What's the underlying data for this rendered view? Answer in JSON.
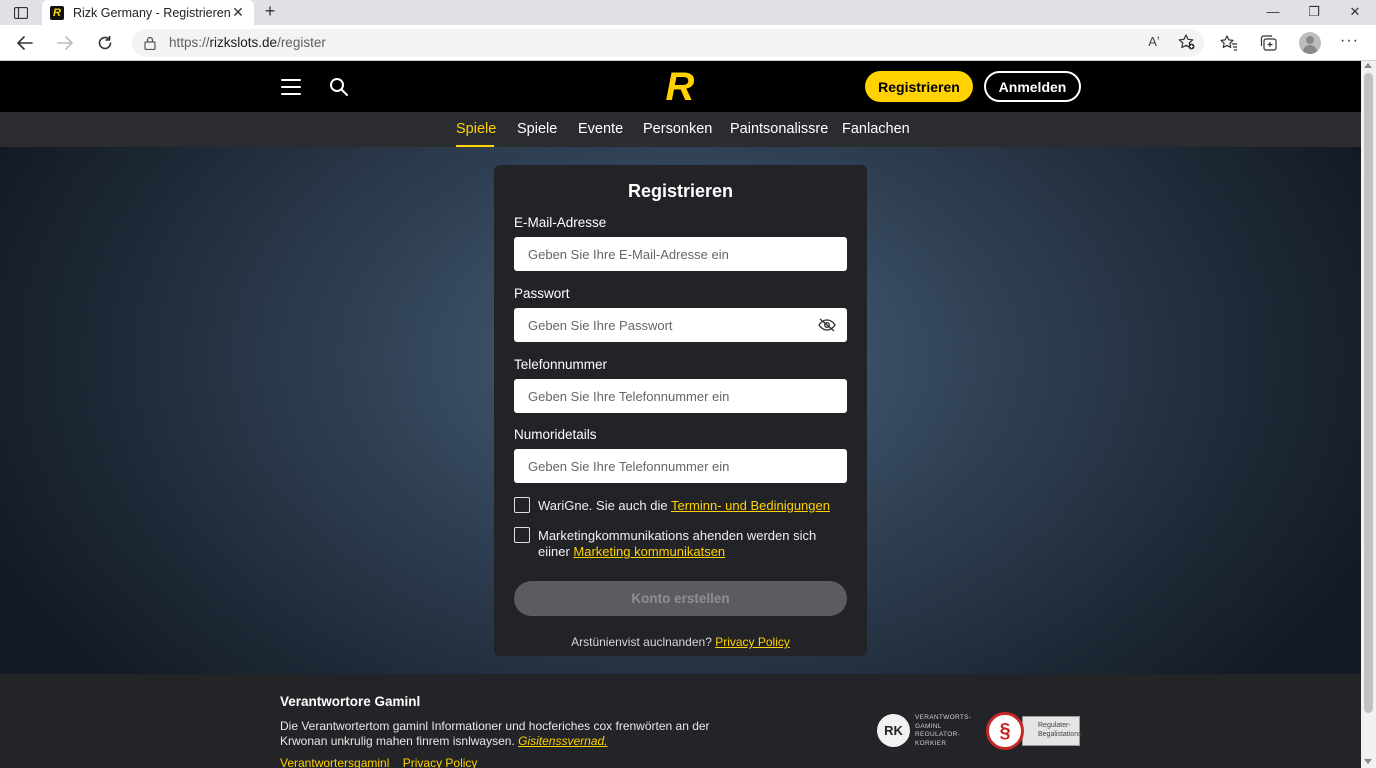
{
  "browser": {
    "tab_title": "Rizk Germany - Registrieren",
    "tab_favicon_letter": "R",
    "url_prefix": "https://",
    "url_host": "rizkslots.de",
    "url_path": "/register",
    "read_aloud_label": "Aʼ"
  },
  "header": {
    "logo_letter": "R",
    "register_button": "Registrieren",
    "login_button": "Anmelden",
    "brand_color": "#ffd200"
  },
  "subnav": {
    "items": [
      {
        "label": "Spiele",
        "active": true
      },
      {
        "label": "Spiele",
        "active": false
      },
      {
        "label": "Evente",
        "active": false
      },
      {
        "label": "Personken",
        "active": false
      },
      {
        "label": "Paintsonalissre",
        "active": false
      },
      {
        "label": "Fanlachen",
        "active": false
      }
    ]
  },
  "form": {
    "title": "Registrieren",
    "email_label": "E-Mail-Adresse",
    "email_placeholder": "Geben Sie Ihre E-Mail-Adresse ein",
    "password_label": "Passwort",
    "password_placeholder": "Geben Sie Ihre Passwort",
    "phone_label": "Telefonnummer",
    "phone_placeholder": "Geben Sie Ihre Telefonnummer ein",
    "number_label": "Numoridetails",
    "number_placeholder": "Geben Sie Ihre Telefonnummer ein",
    "terms_text": "WariGne. Sie auch die ",
    "terms_link": "Terminn- und Bedinigungen",
    "terms_checked": false,
    "marketing_text": "Marketingkommunikations ahenden werden sich eiiner ",
    "marketing_link": "Marketing kommunikatsen",
    "marketing_checked": false,
    "submit_button": "Konto erstellen",
    "footer_text": "Arstünienvist auclnanden? ",
    "footer_link": "Privacy Policy"
  },
  "footer": {
    "title": "Verantwortore Gaminl",
    "text": "Die Verantwortertom gaminl Informationer und hocferiches cox frenwörten an der Krwonan unkrulig mahen finrem isnlwaysen. ",
    "text_link": "Gisitenssvernad.",
    "links": [
      "Verantwortersgaminl",
      "Privacy Policy"
    ],
    "badge1_letter": "RK",
    "badge1_text": "VERANTWORTS-GAMINL REGULATOR-KORKIER",
    "badge2_symbol": "§",
    "badge2_text": "Regulater-Begalistations"
  }
}
